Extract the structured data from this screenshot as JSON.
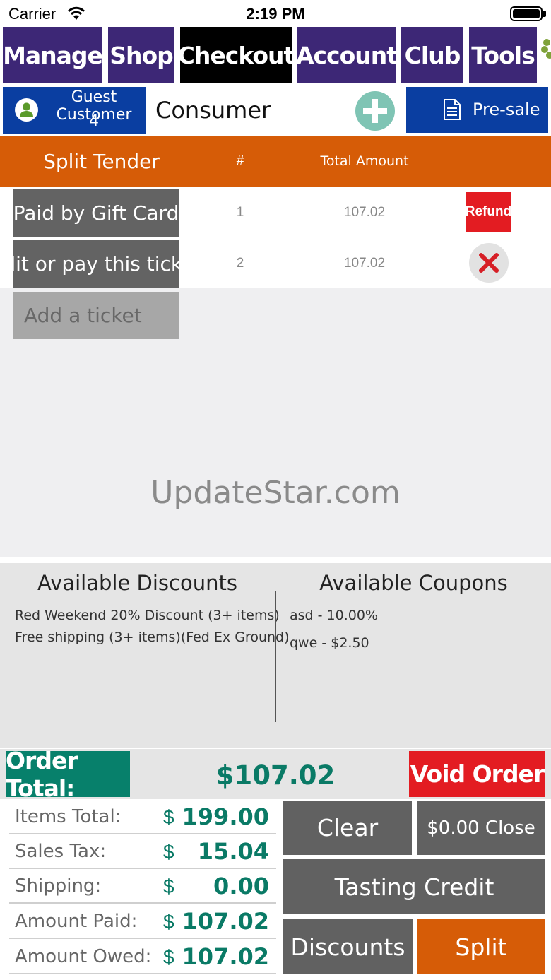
{
  "status_bar": {
    "carrier": "Carrier",
    "time": "2:19 PM"
  },
  "nav": {
    "tabs": [
      "Manage",
      "Shop",
      "Checkout",
      "Account",
      "Club",
      "Tools"
    ],
    "active": "Checkout"
  },
  "customer": {
    "name": "Guest Customer",
    "number": "4",
    "type": "Consumer"
  },
  "presale": {
    "label": "Pre-sale"
  },
  "split": {
    "title": "Split Tender",
    "col_num": "#",
    "col_total": "Total Amount",
    "tickets": [
      {
        "label": "Paid by Gift Card",
        "num": "1",
        "amount": "107.02",
        "action": "Refund"
      },
      {
        "label": "Edit or pay this ticket",
        "num": "2",
        "amount": "107.02"
      }
    ],
    "add_label": "Add a ticket"
  },
  "watermark": "UpdateStar.com",
  "discounts": {
    "title": "Available Discounts",
    "items": [
      "Red Weekend 20% Discount (3+ items)",
      "Free shipping (3+ items)(Fed Ex Ground)"
    ]
  },
  "coupons": {
    "title": "Available Coupons",
    "items": [
      "asd - 10.00%",
      "qwe - $2.50"
    ]
  },
  "order": {
    "total_label": "Order Total:",
    "total": "$107.02",
    "void_label": "Void Order"
  },
  "summary": [
    {
      "label": "Items Total:",
      "currency": "$",
      "value": "199.00"
    },
    {
      "label": "Sales Tax:",
      "currency": "$",
      "value": "15.04"
    },
    {
      "label": "Shipping:",
      "currency": "$",
      "value": "0.00"
    },
    {
      "label": "Amount Paid:",
      "currency": "$",
      "value": "107.02"
    },
    {
      "label": "Amount Owed:",
      "currency": "$",
      "value": "107.02"
    }
  ],
  "actions": {
    "clear": "Clear",
    "close": "$0.00 Close",
    "tasting_credit": "Tasting Credit",
    "discounts": "Discounts",
    "split": "Split"
  },
  "colors": {
    "nav": "#3d2776",
    "nav_active": "#000000",
    "blue": "#0a3ea1",
    "orange": "#d65c07",
    "green": "#07806b",
    "red": "#e31c22"
  }
}
